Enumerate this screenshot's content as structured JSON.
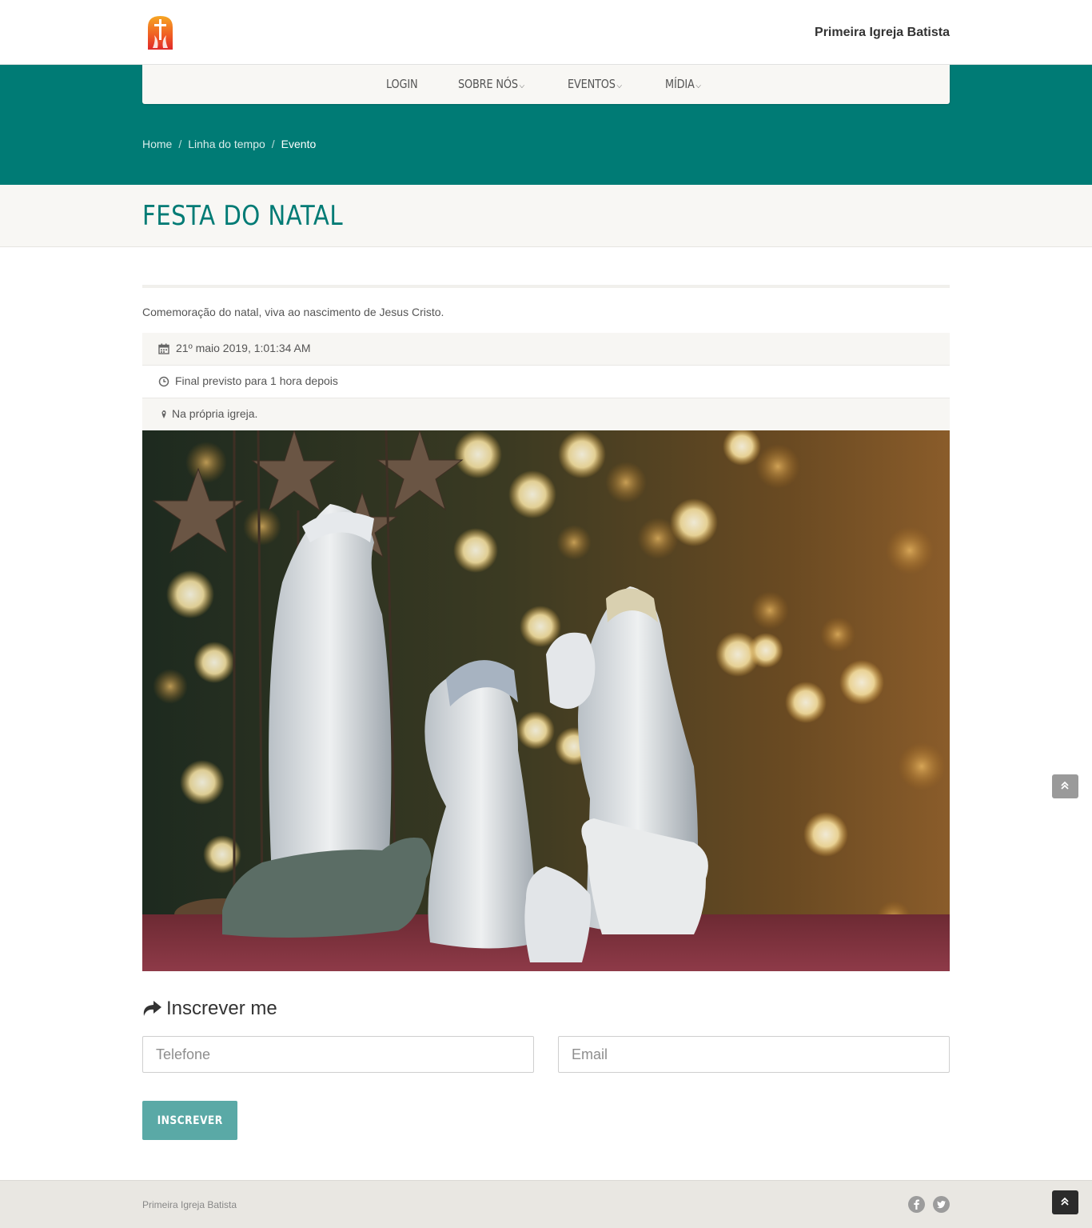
{
  "header": {
    "site_name": "Primeira Igreja Batista",
    "logo": "church-cross-flame-logo"
  },
  "nav": {
    "items": [
      {
        "label": "LOGIN",
        "has_dropdown": false
      },
      {
        "label": "SOBRE NÓS",
        "has_dropdown": true
      },
      {
        "label": "EVENTOS",
        "has_dropdown": true
      },
      {
        "label": "MÍDIA",
        "has_dropdown": true
      }
    ],
    "caret": "⌵"
  },
  "breadcrumb": {
    "items": [
      "Home",
      "Linha do tempo",
      "Evento"
    ],
    "separator": "/"
  },
  "event": {
    "title": "FESTA DO NATAL",
    "description": "Comemoração do natal, viva ao nascimento de Jesus Cristo.",
    "date": "21º maio 2019, 1:01:34 AM",
    "duration": "Final previsto para 1 hora depois",
    "location": "Na própria igreja.",
    "image": "nativity-scene-photo"
  },
  "signup": {
    "title": "Inscrever me",
    "phone_placeholder": "Telefone",
    "email_placeholder": "Email",
    "phone_value": "",
    "email_value": "",
    "submit_label": "INSCREVER"
  },
  "footer": {
    "text": "Primeira Igreja Batista",
    "social": [
      "facebook-icon",
      "twitter-icon"
    ]
  },
  "colors": {
    "primary": "#007b75",
    "button": "#5aa9a6",
    "light_band": "#f8f7f4",
    "footer": "#e9e7e2"
  }
}
